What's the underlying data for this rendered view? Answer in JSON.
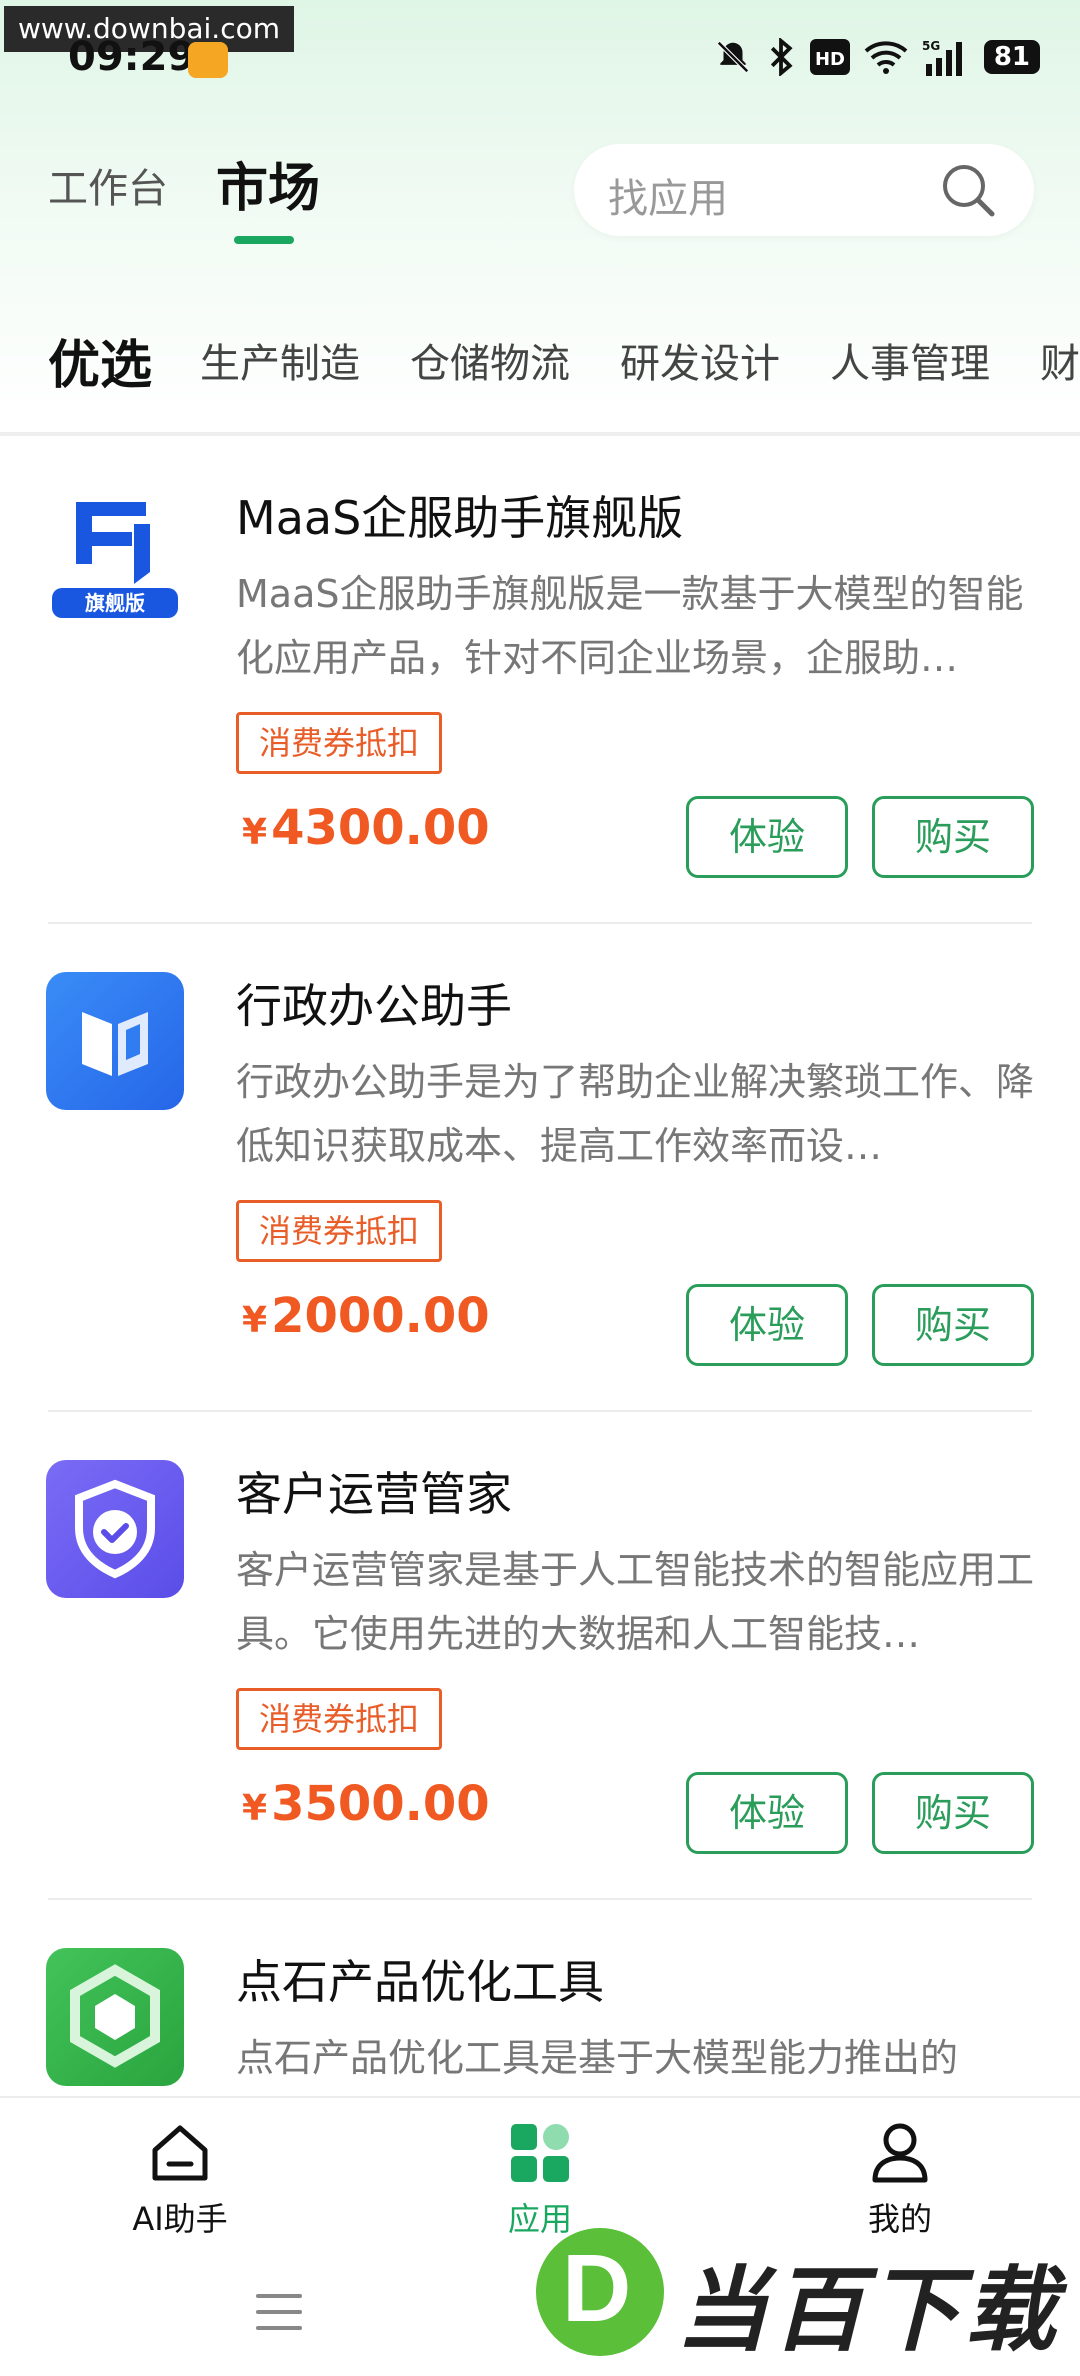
{
  "watermark_top": "www.downbai.com",
  "status": {
    "time": "09:29",
    "battery": "81",
    "hd_label": "HD",
    "network_label": "5G"
  },
  "header": {
    "tab_workbench": "工作台",
    "tab_market": "市场",
    "search_placeholder": "找应用"
  },
  "categories": [
    "优选",
    "生产制造",
    "仓储物流",
    "研发设计",
    "人事管理",
    "财务"
  ],
  "products": [
    {
      "title": "MaaS企服助手旗舰版",
      "desc": "MaaS企服助手旗舰版是一款基于大模型的智能化应用产品，针对不同企业场景，企服助…",
      "tag": "消费券抵扣",
      "currency": "¥",
      "price": "4300.00",
      "logo_label": "旗舰版",
      "logo_icon": "maas-icon",
      "logo_color": "#1a57e0"
    },
    {
      "title": "行政办公助手",
      "desc": "行政办公助手是为了帮助企业解决繁琐工作、降低知识获取成本、提高工作效率而设…",
      "tag": "消费券抵扣",
      "currency": "¥",
      "price": "2000.00",
      "logo_icon": "book-icon",
      "logo_color": "#2f7df0"
    },
    {
      "title": "客户运营管家",
      "desc": "客户运营管家是基于人工智能技术的智能应用工具。它使用先进的大数据和人工智能技…",
      "tag": "消费券抵扣",
      "currency": "¥",
      "price": "3500.00",
      "logo_icon": "shield-check-icon",
      "logo_color": "#6a5cf0"
    },
    {
      "title": "点石产品优化工具",
      "desc": "点石产品优化工具是基于大模型能力推出的",
      "logo_icon": "hexagon-icon",
      "logo_color": "#34b34a"
    }
  ],
  "buttons": {
    "try": "体验",
    "buy": "购买"
  },
  "bottom_nav": [
    {
      "label": "AI助手",
      "icon": "home-icon"
    },
    {
      "label": "应用",
      "icon": "apps-grid-icon",
      "active": true
    },
    {
      "label": "我的",
      "icon": "person-icon"
    }
  ],
  "watermark_brand": "当百下载",
  "watermark_letter": "D",
  "colors": {
    "accent_green": "#1aa760",
    "price_orange": "#f05a22"
  }
}
